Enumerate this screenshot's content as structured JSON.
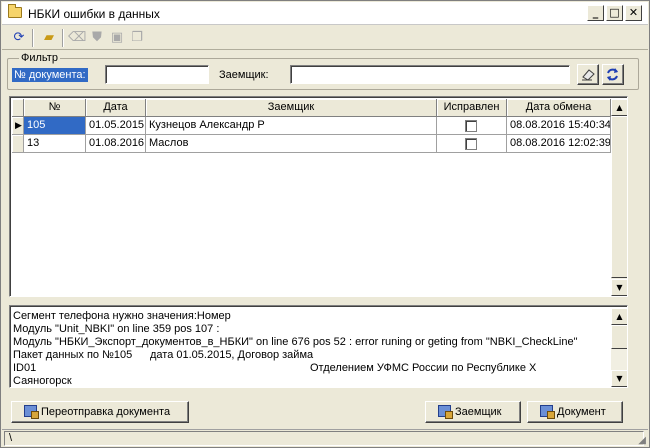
{
  "window": {
    "title": "НБКИ ошибки в данных",
    "buttons": [
      "_",
      "□",
      "✕"
    ]
  },
  "toolbar": {
    "icons": [
      "refresh-icon",
      "open-folder-icon",
      "eraser-icon",
      "stamp-icon",
      "disk-flag-icon",
      "copy-icon"
    ]
  },
  "filter": {
    "legend": "Фильтр",
    "doc_label": "№ документа:",
    "doc_value": "",
    "borrower_label": "Заемщик:",
    "borrower_value": ""
  },
  "grid": {
    "columns": [
      "№",
      "Дата",
      "Заемщик",
      "Исправлен",
      "Дата обмена"
    ],
    "rows": [
      {
        "num": "105",
        "date": "01.05.2015",
        "borrower": "Кузнецов Александр Р",
        "fixed": false,
        "exchange": "08.08.2016 15:40:34",
        "current": true
      },
      {
        "num": "13",
        "date": "01.08.2016",
        "borrower": "Маслов",
        "fixed": false,
        "exchange": "08.08.2016 12:02:39",
        "current": false
      }
    ]
  },
  "memo": {
    "lines": [
      "Сегмент телефона нужно значения:Номер",
      "Модуль \"Unit_NBKI\" on line 359 pos 107 :",
      "Модуль \"НБКИ_Экспорт_документов_в_НБКИ\" on line 676 pos 52 : error runing or geting from \"NBKI_CheckLine\"",
      "Пакет данных по №105",
      "дата 01.05.2015, Договор займа",
      "ID01",
      "Отделением УФМС России по Республике Х",
      "Саяногорск"
    ]
  },
  "buttons": {
    "resend": "Переотправка документа",
    "borrower": "Заемщик",
    "document": "Документ"
  },
  "status": {
    "text": "\\"
  }
}
